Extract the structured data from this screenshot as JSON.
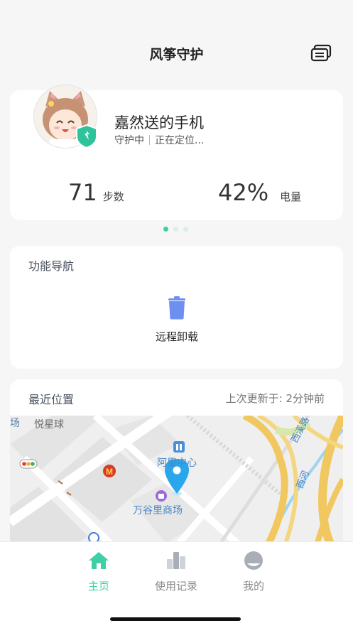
{
  "header": {
    "title": "风筝守护"
  },
  "device": {
    "name": "嘉然送的手机",
    "status": "守护中",
    "location_status": "正在定位...",
    "steps_value": "71",
    "steps_unit": "步数",
    "battery_value": "42%",
    "battery_unit": "电量"
  },
  "carousel": {
    "total": 3,
    "active_index": 0
  },
  "nav": {
    "title": "功能导航",
    "features": [
      {
        "label": "远程卸载",
        "icon": "trash-icon"
      }
    ]
  },
  "location": {
    "title": "最近位置",
    "updated": "上次更新于: 2分钟前",
    "map_labels": {
      "edge": "场",
      "bowling": "悦星球",
      "center": "阿里中心",
      "mall": "万谷里商场",
      "road_west": "西溪路",
      "river": "西河"
    }
  },
  "tabs": [
    {
      "label": "主页",
      "icon": "home-icon",
      "active": true
    },
    {
      "label": "使用记录",
      "icon": "records-icon",
      "active": false
    },
    {
      "label": "我的",
      "icon": "profile-icon",
      "active": false
    }
  ],
  "colors": {
    "accent": "#3ecfa6",
    "marker": "#2aa7ec",
    "feature_icon": "#6f8ff0",
    "inactive": "#8a8a8a"
  }
}
